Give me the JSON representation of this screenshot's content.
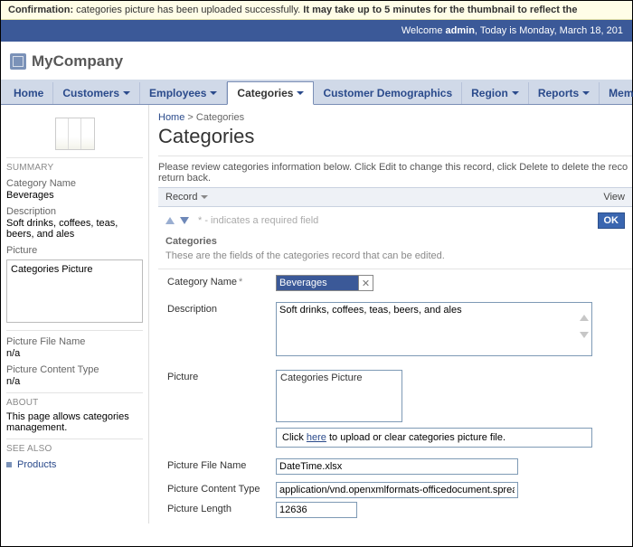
{
  "confirmation": {
    "prefix": "Confirmation:",
    "msg": "categories picture has been uploaded successfully.",
    "tail": "It may take up to 5 minutes for the thumbnail to reflect the"
  },
  "welcome": {
    "pre": "Welcome ",
    "user": "admin",
    "mid": ", Today is ",
    "date": "Monday, March 18, 201"
  },
  "logo": "MyCompany",
  "tabs": {
    "home": "Home",
    "customers": "Customers",
    "employees": "Employees",
    "categories": "Categories",
    "demographics": "Customer Demographics",
    "region": "Region",
    "reports": "Reports",
    "members": "Memb"
  },
  "breadcrumb": {
    "home": "Home",
    "sep": ">",
    "current": "Categories"
  },
  "page_title": "Categories",
  "instructions": "Please review categories information below. Click Edit to change this record, click Delete to delete the reco return back.",
  "record_bar": {
    "record": "Record",
    "view": "View"
  },
  "required_hint": "* - indicates a required field",
  "ok": "OK",
  "section": {
    "title": "Categories",
    "sub": "These are the fields of the categories record that can be edited."
  },
  "form": {
    "category_name_label": "Category Name",
    "category_name_value": "Beverages",
    "description_label": "Description",
    "description_value": "Soft drinks, coffees, teas, beers, and ales",
    "picture_label": "Picture",
    "picture_box_text": "Categories Picture",
    "upload_pre": "Click ",
    "upload_link": "here",
    "upload_post": " to upload or clear categories picture file.",
    "pfn_label": "Picture File Name",
    "pfn_value": "DateTime.xlsx",
    "pct_label": "Picture Content Type",
    "pct_value": "application/vnd.openxmlformats-officedocument.sprea",
    "pl_label": "Picture Length",
    "pl_value": "12636"
  },
  "sidebar": {
    "summary": "SUMMARY",
    "cat_name_label": "Category Name",
    "cat_name_value": "Beverages",
    "desc_label": "Description",
    "desc_value": "Soft drinks, coffees, teas, beers, and ales",
    "picture_label": "Picture",
    "picture_value": "Categories Picture",
    "pfn_label": "Picture File Name",
    "pfn_value": "n/a",
    "pct_label": "Picture Content Type",
    "pct_value": "n/a",
    "about": "ABOUT",
    "about_text": "This page allows categories management.",
    "see_also": "SEE ALSO",
    "see_also_item": "Products"
  }
}
